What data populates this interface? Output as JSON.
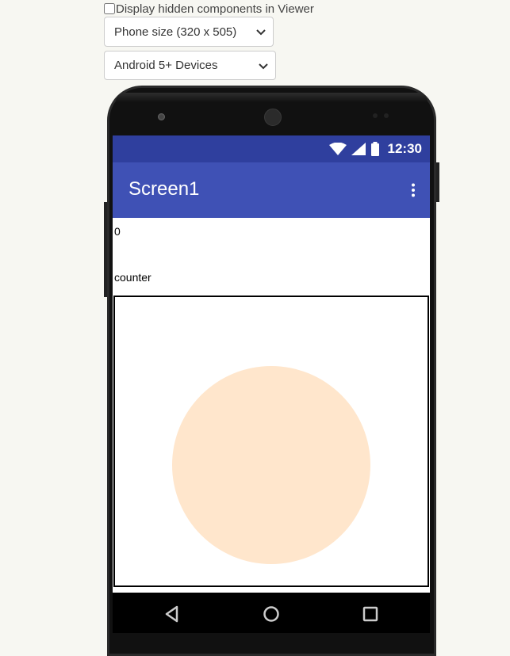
{
  "options": {
    "hidden_components_label": "Display hidden components in Viewer",
    "phone_size": "Phone size (320 x 505)",
    "device": "Android 5+ Devices"
  },
  "status_bar": {
    "time": "12:30"
  },
  "app_bar": {
    "title": "Screen1"
  },
  "components": {
    "label_value": "0",
    "label_counter": "counter"
  },
  "colors": {
    "status_bar": "#2f3f9e",
    "app_bar": "#3f51b5",
    "ball": "#ffe6cc"
  },
  "icons": {
    "select_arrow": "chevron-down-icon",
    "wifi": "wifi-icon",
    "signal": "signal-icon",
    "battery": "battery-icon",
    "menu": "more-vert-icon",
    "back": "back-icon",
    "home": "home-icon",
    "recents": "recents-icon"
  }
}
